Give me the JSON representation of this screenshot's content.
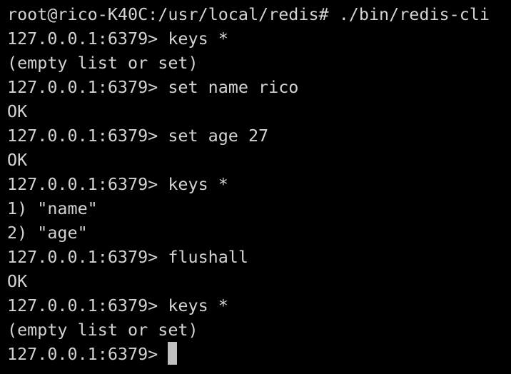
{
  "terminal": {
    "lines": [
      "root@rico-K40C:/usr/local/redis# ./bin/redis-cli",
      "127.0.0.1:6379> keys *",
      "(empty list or set)",
      "127.0.0.1:6379> set name rico",
      "OK",
      "127.0.0.1:6379> set age 27",
      "OK",
      "127.0.0.1:6379> keys *",
      "1) \"name\"",
      "2) \"age\"",
      "127.0.0.1:6379> flushall",
      "OK",
      "127.0.0.1:6379> keys *",
      "(empty list or set)"
    ],
    "prompt": "127.0.0.1:6379>"
  }
}
